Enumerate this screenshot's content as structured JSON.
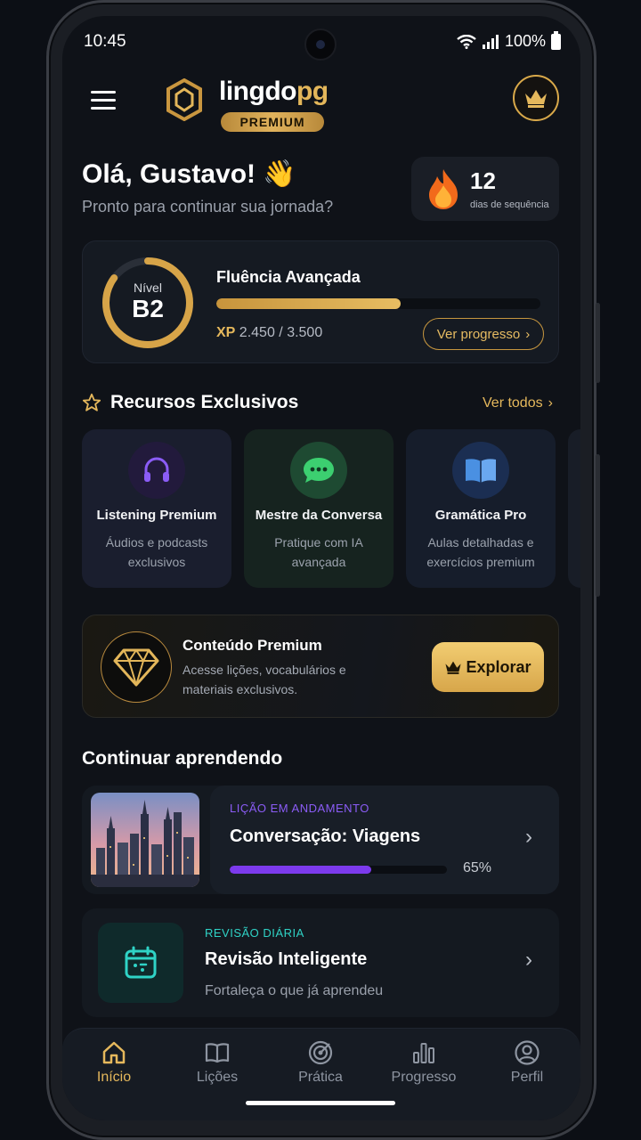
{
  "status": {
    "time": "10:45",
    "battery": "100%"
  },
  "brand": {
    "name_main": "lingdo",
    "name_accent": "pg",
    "badge": "PREMIUM"
  },
  "greeting": {
    "title": "Olá, Gustavo! 👋",
    "subtitle": "Pronto para continuar sua jornada?"
  },
  "streak": {
    "count": "12",
    "label": "dias de sequência"
  },
  "level": {
    "ring_label": "Nível",
    "code": "B2",
    "title": "Fluência Avançada",
    "xp_prefix": "XP",
    "xp_current": "2.450",
    "xp_total": "/ 3.500",
    "progress": 0.57,
    "button": "Ver progresso"
  },
  "features_section": {
    "title": "Recursos Exclusivos",
    "see_all": "Ver todos"
  },
  "features": [
    {
      "title": "Listening Premium",
      "desc": "Áudios e podcasts exclusivos",
      "icon": "headphones-icon",
      "bg": "#1a1e2e",
      "icon_bg": "#221a3c",
      "icon_color": "#8b5cf6"
    },
    {
      "title": "Mestre da Conversa",
      "desc": "Pratique com IA avançada",
      "icon": "chat-bubble-icon",
      "bg": "#16231f",
      "icon_bg": "#1e4a32",
      "icon_color": "#3ccf70"
    },
    {
      "title": "Gramática Pro",
      "desc": "Aulas detalhadas e exercícios premium",
      "icon": "book-icon",
      "bg": "#161d2b",
      "icon_bg": "#1b2e52",
      "icon_color": "#4a90e2"
    }
  ],
  "premium": {
    "title": "Conteúdo Premium",
    "desc": "Acesse lições, vocabulários e materiais exclusivos.",
    "button": "Explorar"
  },
  "continue": {
    "title": "Continuar aprendendo"
  },
  "lesson": {
    "tag": "LIÇÃO EM ANDAMENTO",
    "title": "Conversação: Viagens",
    "percent_text": "65%",
    "progress": 0.65
  },
  "review": {
    "tag": "REVISÃO DIÁRIA",
    "title": "Revisão Inteligente",
    "desc": "Fortaleça o que já aprendeu"
  },
  "nav": [
    {
      "label": "Início",
      "icon": "home-icon",
      "active": true
    },
    {
      "label": "Lições",
      "icon": "book-open-icon",
      "active": false
    },
    {
      "label": "Prática",
      "icon": "target-icon",
      "active": false
    },
    {
      "label": "Progresso",
      "icon": "bar-chart-icon",
      "active": false
    },
    {
      "label": "Perfil",
      "icon": "user-icon",
      "active": false
    }
  ],
  "colors": {
    "accent": "#e5b85c",
    "purple": "#7c3aed",
    "teal": "#2fd3c6"
  }
}
